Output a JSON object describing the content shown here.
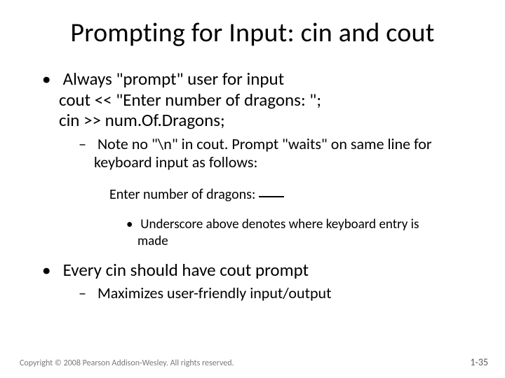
{
  "title": "Prompting for Input: cin and cout",
  "bullets": {
    "b1_line1": "Always \"prompt\" user for input",
    "b1_line2": "cout << \"Enter number of dragons: \";",
    "b1_line3": "cin >> num.Of.Dragons;",
    "b1_sub1": "Note no \"\\n\" in cout.  Prompt \"waits\" on same line for keyboard input as follows:",
    "example": "Enter number of dragons: ",
    "b1_sub1_note": "Underscore above denotes where keyboard entry is made",
    "b2": "Every cin should have cout prompt",
    "b2_sub1": "Maximizes user-friendly input/output"
  },
  "footer": {
    "copyright": "Copyright © 2008 Pearson Addison-Wesley. All rights reserved.",
    "page": "1-35"
  }
}
